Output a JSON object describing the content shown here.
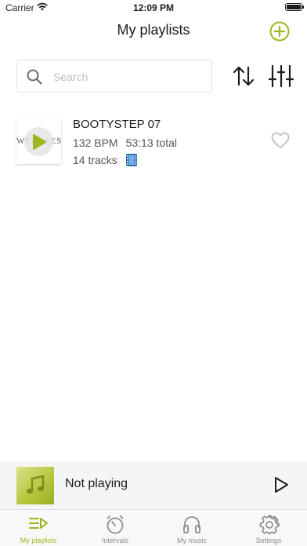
{
  "status_bar": {
    "carrier": "Carrier",
    "time": "12:09 PM",
    "battery_level": 1.0
  },
  "header": {
    "title": "My playlists",
    "add_icon": "plus-circle-icon"
  },
  "toolbar": {
    "search_placeholder": "Search",
    "search_value": "",
    "sort_icon": "sort-arrows-icon",
    "filter_icon": "sliders-icon"
  },
  "playlists": [
    {
      "name": "BOOTYSTEP 07",
      "bpm": "132 BPM",
      "total": "53:13 total",
      "tracks": "14 tracks",
      "artwork_text": "WELLNESS",
      "has_video": true,
      "favorite": false
    }
  ],
  "now_playing": {
    "label": "Not playing"
  },
  "tabs": [
    {
      "label": "My playlists",
      "icon": "playlist-icon",
      "active": true
    },
    {
      "label": "Intervals",
      "icon": "stopwatch-icon",
      "active": false
    },
    {
      "label": "My music",
      "icon": "headphones-icon",
      "active": false
    },
    {
      "label": "Settings",
      "icon": "gear-icon",
      "active": false
    }
  ],
  "colors": {
    "accent": "#9bb81e",
    "inactive": "#8e8e93",
    "text": "#1c1c1e"
  }
}
